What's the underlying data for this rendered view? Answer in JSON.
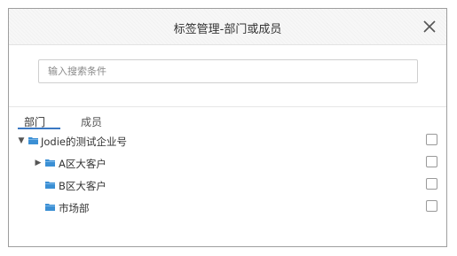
{
  "dialog": {
    "title": "标签管理-部门或成员",
    "close_icon": "close-icon"
  },
  "search": {
    "placeholder": "输入搜索条件",
    "value": ""
  },
  "tabs": [
    {
      "label": "部门",
      "active": true
    },
    {
      "label": "成员",
      "active": false
    }
  ],
  "tree": {
    "nodes": [
      {
        "label": "Jodie的测试企业号",
        "expander": "▼",
        "checked": false
      },
      {
        "label": "A区大客户",
        "expander": "▶",
        "checked": false
      },
      {
        "label": "B区大客户",
        "expander": "",
        "checked": false
      },
      {
        "label": "市场部",
        "expander": "",
        "checked": false
      }
    ]
  },
  "colors": {
    "accent": "#3a78c3",
    "folder": "#3b8fd4",
    "border": "#9e9e9e"
  }
}
